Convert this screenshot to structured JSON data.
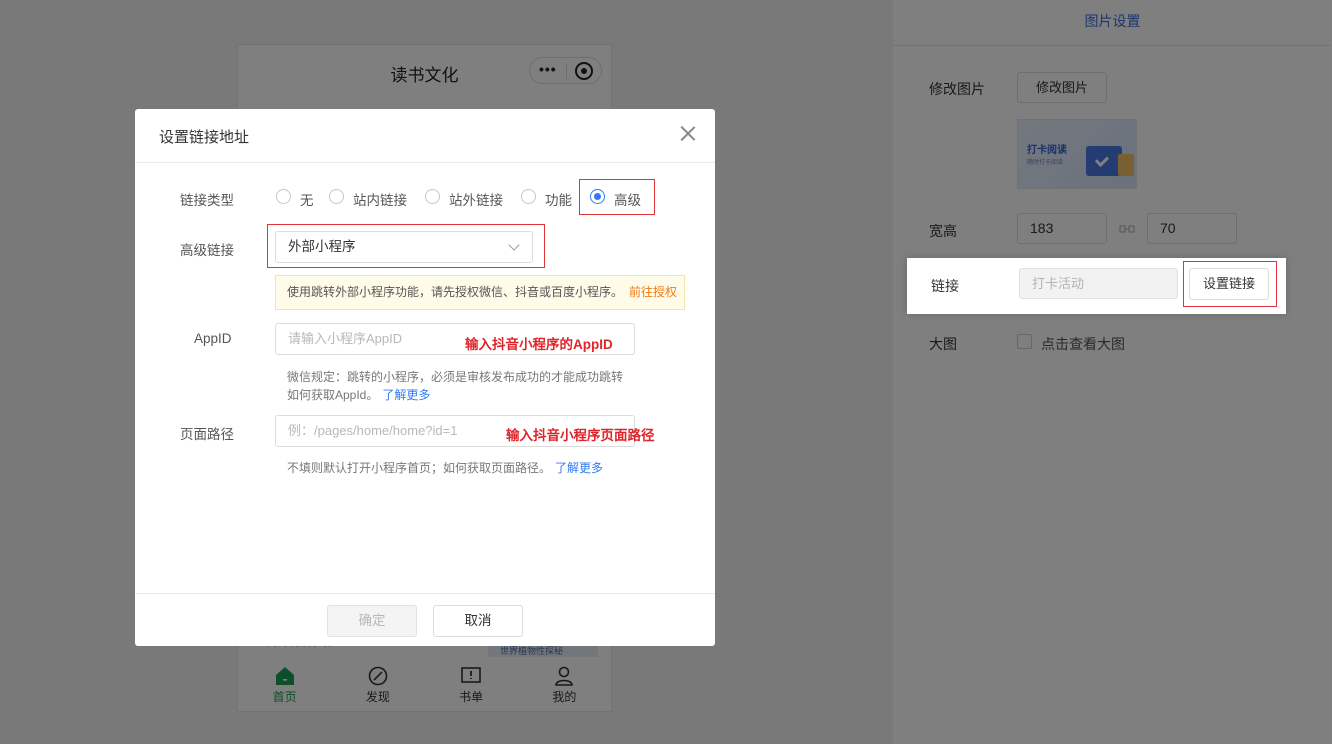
{
  "phone": {
    "title": "读书文化",
    "capsule_dots": "•••",
    "peek_left_text": "世界读物推荐",
    "peek_image_text": "世界植物性探秘",
    "tabs": [
      {
        "label": "首页",
        "icon": "home-icon",
        "active": true
      },
      {
        "label": "发现",
        "icon": "compass-icon",
        "active": false
      },
      {
        "label": "书单",
        "icon": "booklist-icon",
        "active": false
      },
      {
        "label": "我的",
        "icon": "user-icon",
        "active": false
      }
    ],
    "active_color": "#1a9e55"
  },
  "panel": {
    "header": "图片设置",
    "modify_image_label": "修改图片",
    "modify_image_button": "修改图片",
    "thumb_title": "打卡阅读",
    "thumb_subtitle": "随时打卡阅读",
    "size_label": "宽高",
    "width_value": "183",
    "height_value": "70",
    "link_label": "链接",
    "link_placeholder": "打卡活动",
    "set_link_button": "设置链接",
    "big_image_label": "大图",
    "big_image_checkbox": "点击查看大图",
    "accent_color": "#3a6de0"
  },
  "dialog": {
    "title": "设置链接地址",
    "link_type_label": "链接类型",
    "link_types": [
      {
        "label": "无",
        "selected": false
      },
      {
        "label": "站内链接",
        "selected": false
      },
      {
        "label": "站外链接",
        "selected": false
      },
      {
        "label": "功能",
        "selected": false
      },
      {
        "label": "高级",
        "selected": true
      }
    ],
    "advanced_label": "高级链接",
    "advanced_value": "外部小程序",
    "notice_text": "使用跳转外部小程序功能，请先授权微信、抖音或百度小程序。",
    "notice_link": "前往授权",
    "appid_label": "AppID",
    "appid_placeholder": "请输入小程序AppID",
    "appid_annotation": "输入抖音小程序的AppID",
    "appid_hint_line1": "微信规定：跳转的小程序，必须是审核发布成功的才能成功跳转",
    "appid_hint_line2": "如何获取AppId。",
    "appid_hint_more": "了解更多",
    "path_label": "页面路径",
    "path_placeholder": "例：/pages/home/home?id=1",
    "path_annotation": "输入抖音小程序页面路径",
    "path_hint": "不填则默认打开小程序首页；如何获取页面路径。",
    "path_hint_more": "了解更多",
    "confirm_button": "确定",
    "cancel_button": "取消",
    "selected_color": "#2f7bf5",
    "annotation_color": "#e0242a"
  }
}
